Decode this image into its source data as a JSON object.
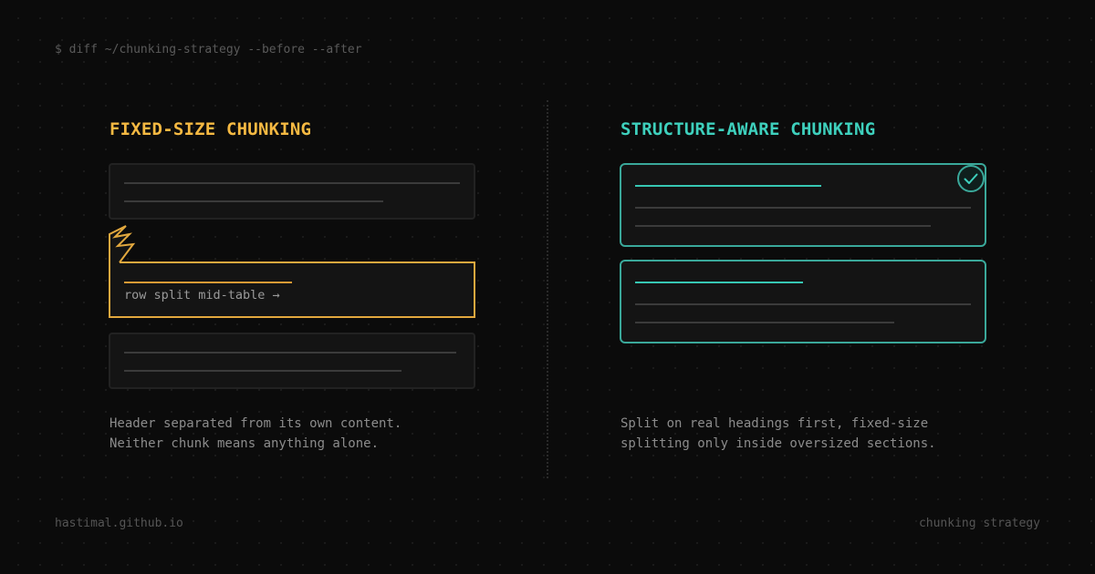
{
  "header": {
    "command": "$ diff ~/chunking-strategy --before --after"
  },
  "left_panel": {
    "title": "FIXED-SIZE CHUNKING",
    "split_label": "row split mid-table →",
    "description_line1": "Header separated from its own content.",
    "description_line2": "Neither chunk means anything alone.",
    "accent_color": "#f5b942"
  },
  "right_panel": {
    "title": "STRUCTURE-AWARE CHUNKING",
    "description_line1": "Split on real headings first, fixed-size",
    "description_line2": "splitting only inside oversized sections.",
    "accent_color": "#3ed0bd",
    "icon": "check-circle-icon"
  },
  "footer": {
    "site": "hastimal.github.io",
    "topic": "chunking strategy"
  }
}
